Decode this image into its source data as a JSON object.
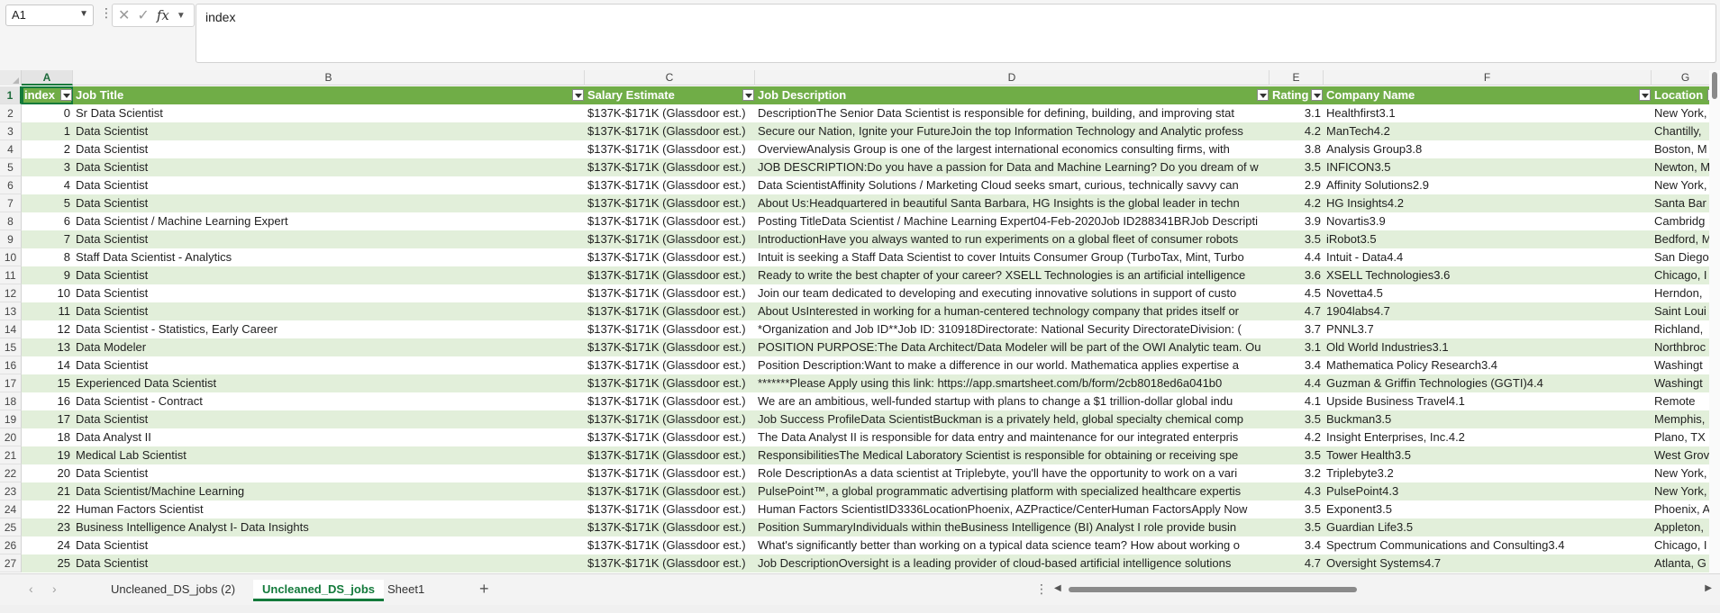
{
  "formula_bar": {
    "name_box": "A1",
    "formula": "index"
  },
  "columns": [
    "A",
    "B",
    "C",
    "D",
    "E",
    "F",
    "G"
  ],
  "rows": [
    {
      "n": "1",
      "index": "index",
      "title": "Job Title",
      "salary": "Salary Estimate",
      "desc": "Job Description",
      "rating": "Rating",
      "company": "Company Name",
      "location": "Location"
    },
    {
      "n": "2",
      "index": "0",
      "title": "Sr Data Scientist",
      "salary": "$137K-$171K (Glassdoor est.)",
      "desc": "DescriptionThe Senior Data Scientist is responsible for defining, building, and improving stat",
      "rating": "3.1",
      "company": "Healthfirst3.1",
      "location": "New York,"
    },
    {
      "n": "3",
      "index": "1",
      "title": "Data Scientist",
      "salary": "$137K-$171K (Glassdoor est.)",
      "desc": "Secure our Nation, Ignite your FutureJoin the top Information Technology and Analytic profess",
      "rating": "4.2",
      "company": "ManTech4.2",
      "location": "Chantilly,"
    },
    {
      "n": "4",
      "index": "2",
      "title": "Data Scientist",
      "salary": "$137K-$171K (Glassdoor est.)",
      "desc": "OverviewAnalysis Group is one of the largest international economics consulting firms, with",
      "rating": "3.8",
      "company": "Analysis Group3.8",
      "location": "Boston, M"
    },
    {
      "n": "5",
      "index": "3",
      "title": "Data Scientist",
      "salary": "$137K-$171K (Glassdoor est.)",
      "desc": "JOB DESCRIPTION:Do you have a passion for Data and Machine Learning? Do you dream of w",
      "rating": "3.5",
      "company": "INFICON3.5",
      "location": "Newton, M"
    },
    {
      "n": "6",
      "index": "4",
      "title": "Data Scientist",
      "salary": "$137K-$171K (Glassdoor est.)",
      "desc": "Data ScientistAffinity Solutions / Marketing Cloud seeks smart, curious, technically savvy can",
      "rating": "2.9",
      "company": "Affinity Solutions2.9",
      "location": "New York,"
    },
    {
      "n": "7",
      "index": "5",
      "title": "Data Scientist",
      "salary": "$137K-$171K (Glassdoor est.)",
      "desc": "About Us:Headquartered in beautiful Santa Barbara, HG Insights is the global leader in techn",
      "rating": "4.2",
      "company": "HG Insights4.2",
      "location": "Santa Bar"
    },
    {
      "n": "8",
      "index": "6",
      "title": "Data Scientist / Machine Learning Expert",
      "salary": "$137K-$171K (Glassdoor est.)",
      "desc": "Posting TitleData Scientist / Machine Learning Expert04-Feb-2020Job ID288341BRJob Descripti",
      "rating": "3.9",
      "company": "Novartis3.9",
      "location": "Cambridg"
    },
    {
      "n": "9",
      "index": "7",
      "title": "Data Scientist",
      "salary": "$137K-$171K (Glassdoor est.)",
      "desc": "IntroductionHave you always wanted to run experiments on a global fleet of consumer robots",
      "rating": "3.5",
      "company": "iRobot3.5",
      "location": "Bedford, M"
    },
    {
      "n": "10",
      "index": "8",
      "title": "Staff Data Scientist - Analytics",
      "salary": "$137K-$171K (Glassdoor est.)",
      "desc": "Intuit is seeking a Staff Data Scientist to cover Intuits Consumer Group (TurboTax, Mint, Turbo",
      "rating": "4.4",
      "company": "Intuit - Data4.4",
      "location": "San Diego"
    },
    {
      "n": "11",
      "index": "9",
      "title": "Data Scientist",
      "salary": "$137K-$171K (Glassdoor est.)",
      "desc": "Ready to write the best chapter of your career? XSELL Technologies is an artificial intelligence",
      "rating": "3.6",
      "company": "XSELL Technologies3.6",
      "location": "Chicago, I"
    },
    {
      "n": "12",
      "index": "10",
      "title": "Data Scientist",
      "salary": "$137K-$171K (Glassdoor est.)",
      "desc": "Join our team dedicated to developing and executing innovative solutions in support of custo",
      "rating": "4.5",
      "company": "Novetta4.5",
      "location": "Herndon,"
    },
    {
      "n": "13",
      "index": "11",
      "title": "Data Scientist",
      "salary": "$137K-$171K (Glassdoor est.)",
      "desc": "About UsInterested in working for a human-centered technology company that prides itself or",
      "rating": "4.7",
      "company": "1904labs4.7",
      "location": "Saint Loui"
    },
    {
      "n": "14",
      "index": "12",
      "title": "Data Scientist - Statistics, Early Career",
      "salary": "$137K-$171K (Glassdoor est.)",
      "desc": "*Organization and Job ID**Job ID: 310918Directorate: National Security DirectorateDivision: (",
      "rating": "3.7",
      "company": "PNNL3.7",
      "location": "Richland,"
    },
    {
      "n": "15",
      "index": "13",
      "title": "Data Modeler",
      "salary": "$137K-$171K (Glassdoor est.)",
      "desc": "POSITION PURPOSE:The Data Architect/Data Modeler will be part of the OWI Analytic team. Ou",
      "rating": "3.1",
      "company": "Old World Industries3.1",
      "location": "Northbroc"
    },
    {
      "n": "16",
      "index": "14",
      "title": "Data Scientist",
      "salary": "$137K-$171K (Glassdoor est.)",
      "desc": "Position Description:Want to make a difference in our world. Mathematica applies expertise a",
      "rating": "3.4",
      "company": "Mathematica Policy Research3.4",
      "location": "Washingt"
    },
    {
      "n": "17",
      "index": "15",
      "title": "Experienced Data Scientist",
      "salary": "$137K-$171K (Glassdoor est.)",
      "desc": "*******Please Apply using this link: https://app.smartsheet.com/b/form/2cb8018ed6a041b0",
      "rating": "4.4",
      "company": "Guzman & Griffin Technologies (GGTI)4.4",
      "location": "Washingt"
    },
    {
      "n": "18",
      "index": "16",
      "title": "Data Scientist - Contract",
      "salary": "$137K-$171K (Glassdoor est.)",
      "desc": "We are an ambitious, well-funded startup with plans to change a $1 trillion-dollar global indu",
      "rating": "4.1",
      "company": "Upside Business Travel4.1",
      "location": "Remote"
    },
    {
      "n": "19",
      "index": "17",
      "title": "Data Scientist",
      "salary": "$137K-$171K (Glassdoor est.)",
      "desc": "Job Success ProfileData ScientistBuckman is a privately held, global specialty chemical comp",
      "rating": "3.5",
      "company": "Buckman3.5",
      "location": "Memphis,"
    },
    {
      "n": "20",
      "index": "18",
      "title": "Data Analyst II",
      "salary": "$137K-$171K (Glassdoor est.)",
      "desc": "The Data Analyst II is responsible for data entry and maintenance for our integrated enterpris",
      "rating": "4.2",
      "company": "Insight Enterprises, Inc.4.2",
      "location": "Plano, TX"
    },
    {
      "n": "21",
      "index": "19",
      "title": "Medical Lab Scientist",
      "salary": "$137K-$171K (Glassdoor est.)",
      "desc": "ResponsibilitiesThe Medical Laboratory Scientist is responsible for obtaining or receiving spe",
      "rating": "3.5",
      "company": "Tower Health3.5",
      "location": "West Grov"
    },
    {
      "n": "22",
      "index": "20",
      "title": "Data Scientist",
      "salary": "$137K-$171K (Glassdoor est.)",
      "desc": "Role DescriptionAs a data scientist at Triplebyte, you'll have the opportunity to work on a vari",
      "rating": "3.2",
      "company": "Triplebyte3.2",
      "location": "New York,"
    },
    {
      "n": "23",
      "index": "21",
      "title": "Data Scientist/Machine Learning",
      "salary": "$137K-$171K (Glassdoor est.)",
      "desc": "PulsePoint™, a global programmatic advertising platform with specialized healthcare expertis",
      "rating": "4.3",
      "company": "PulsePoint4.3",
      "location": "New York,"
    },
    {
      "n": "24",
      "index": "22",
      "title": "Human Factors Scientist",
      "salary": "$137K-$171K (Glassdoor est.)",
      "desc": "Human Factors ScientistID3336LocationPhoenix, AZPractice/CenterHuman FactorsApply Now",
      "rating": "3.5",
      "company": "Exponent3.5",
      "location": "Phoenix, A"
    },
    {
      "n": "25",
      "index": "23",
      "title": "Business Intelligence Analyst I- Data Insights",
      "salary": "$137K-$171K (Glassdoor est.)",
      "desc": "Position SummaryIndividuals within theBusiness Intelligence (BI) Analyst I role provide busin",
      "rating": "3.5",
      "company": "Guardian Life3.5",
      "location": "Appleton,"
    },
    {
      "n": "26",
      "index": "24",
      "title": "Data Scientist",
      "salary": "$137K-$171K (Glassdoor est.)",
      "desc": "What's significantly better than working on a typical data science team? How about working o",
      "rating": "3.4",
      "company": "Spectrum Communications and Consulting3.4",
      "location": "Chicago, I"
    },
    {
      "n": "27",
      "index": "25",
      "title": "Data Scientist",
      "salary": "$137K-$171K (Glassdoor est.)",
      "desc": "Job DescriptionOversight is a leading provider of cloud-based artificial intelligence solutions",
      "rating": "4.7",
      "company": "Oversight Systems4.7",
      "location": "Atlanta, G"
    }
  ],
  "sheet_tabs": [
    {
      "label": "Uncleaned_DS_jobs (2)",
      "active": false
    },
    {
      "label": "Uncleaned_DS_jobs",
      "active": true
    },
    {
      "label": "Sheet1",
      "active": false
    }
  ],
  "icons": {
    "prev_sheet": "‹",
    "next_sheet": "›",
    "add_sheet": "+",
    "more": "⋮",
    "cancel": "✕",
    "enter": "✓",
    "fx": "fx"
  },
  "colors": {
    "header_fill": "#70ad47",
    "band_fill": "#e2efda",
    "accent": "#137a3b"
  }
}
